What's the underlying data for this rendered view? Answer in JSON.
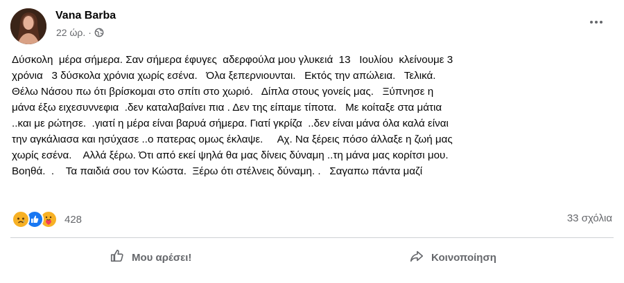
{
  "post": {
    "author": "Vana Barba",
    "time": "22 ώρ.",
    "separator": "·",
    "privacy_icon": "globe-icon",
    "more_icon": "more-options-icon",
    "text_lines": [
      "Δύσκολη  μέρα σήμερα. Σαν σήμερα έφυγες  αδερφούλα μου γλυκειά  13   Ιουλίου  κλείνουμε 3",
      "χρόνια   3 δύσκολα χρόνια χωρίς εσένα.   Όλα ξεπερνιουνται.   Εκτός την απώλεια.   Τελικά.",
      "Θέλω Νάσου πω ότι βρίσκομαι στο σπίτι στο χωριό.   Δίπλα στους γονείς μας.   Ξύπνησε η",
      "μάνα έξω ειχεσυννεφια  .δεν καταλαβαίνει πια . Δεν της είπαμε τίποτα.   Με κοίταξε στα μάτια",
      "..και με ρώτησε.  .γιατί η μέρα είναι βαρυά σήμερα. Γιατί γκρίζα  ..δεν είναι μάνα όλα καλά είναι",
      "την αγκάλιασα και ησύχασε ..ο πατερας ομως έκλαψε.     Αχ. Να ξέρεις πόσο άλλαξε η ζωή μας",
      "χωρίς εσένα.    Αλλά ξέρω. Ότι από εκεί ψηλά θα μας δίνεις δύναμη ..τη μάνα μας κορίτσι μου.",
      "Βοηθά.  .    Τα παιδιά σου τον Κώστα.  Ξέρω ότι στέλνεις δύναμη. .   Σαγαπω πάντα μαζί"
    ]
  },
  "reactions": {
    "icons": [
      "sad-reaction-icon",
      "like-reaction-icon",
      "care-reaction-icon"
    ],
    "count": "428",
    "comments": "33 σχόλια"
  },
  "actions": {
    "like_label": "Μου αρέσει!",
    "share_label": "Κοινοποίηση"
  },
  "colors": {
    "text": "#050505",
    "secondary": "#65676b",
    "like_blue": "#1877f2",
    "reaction_yellow": "#f7b125",
    "divider": "#ced0d4"
  }
}
